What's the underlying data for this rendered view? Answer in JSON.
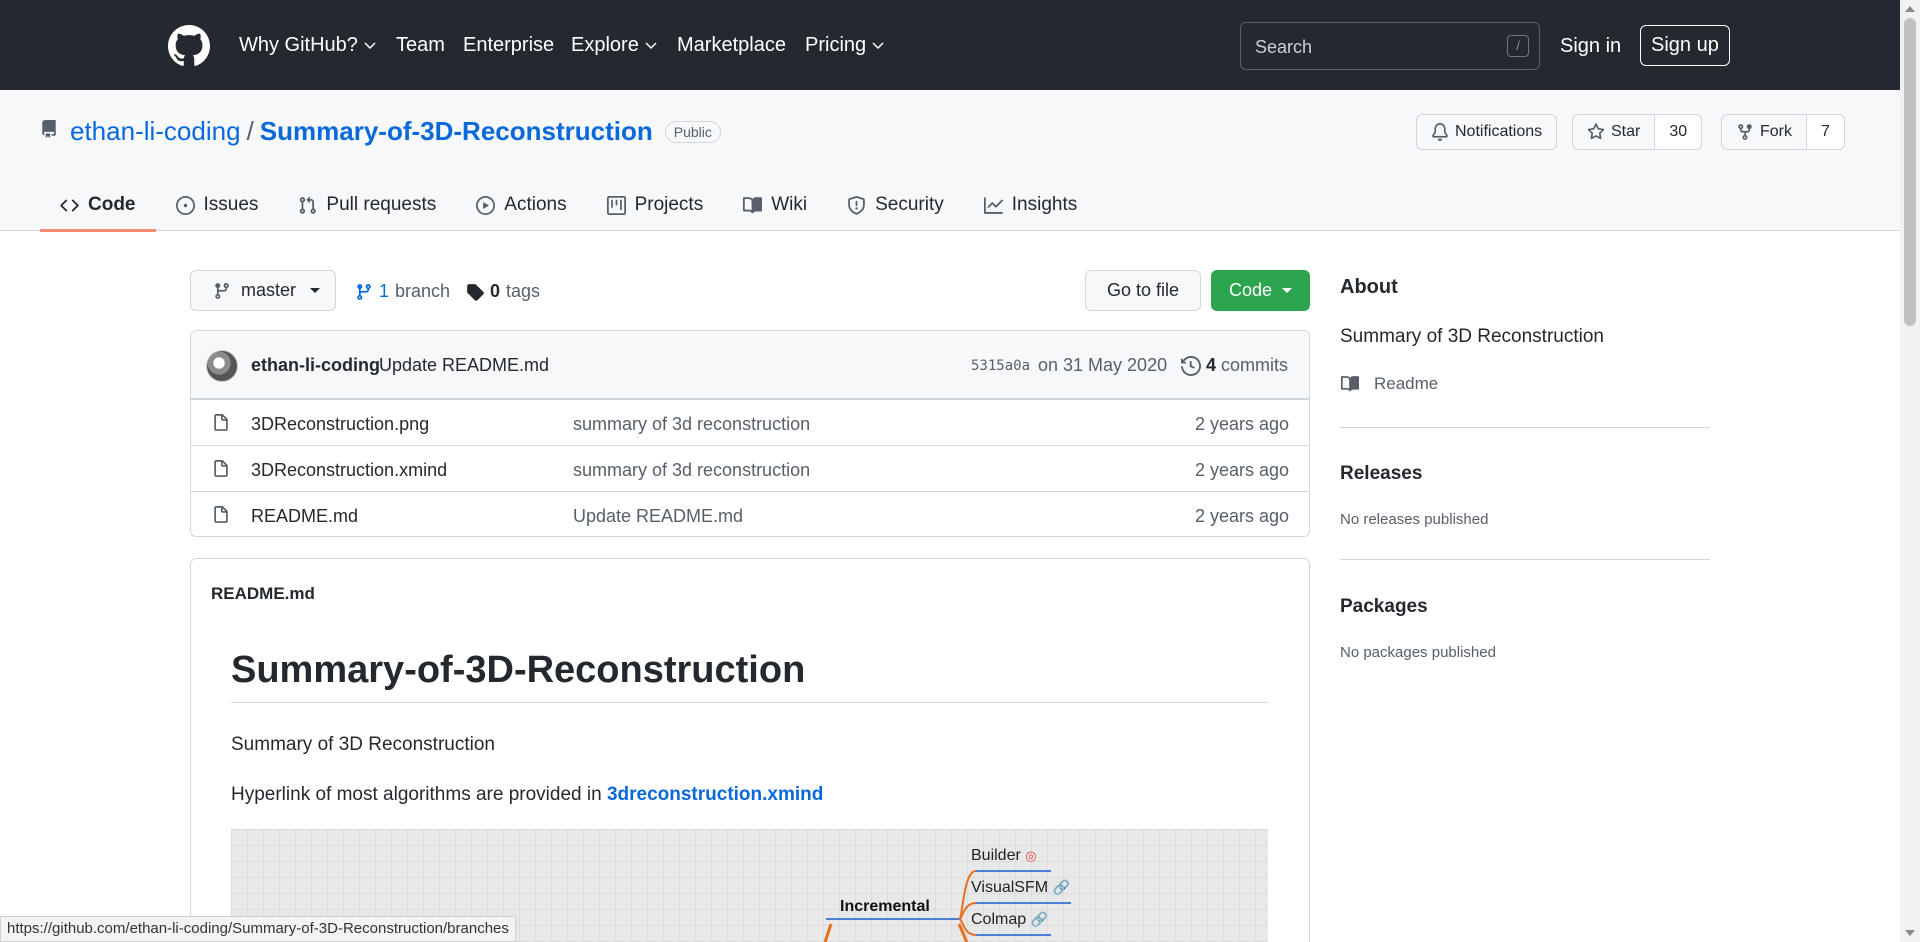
{
  "topnav": {
    "items": [
      {
        "label": "Why GitHub?",
        "dropdown": true
      },
      {
        "label": "Team",
        "dropdown": false
      },
      {
        "label": "Enterprise",
        "dropdown": false
      },
      {
        "label": "Explore",
        "dropdown": true
      },
      {
        "label": "Marketplace",
        "dropdown": false
      },
      {
        "label": "Pricing",
        "dropdown": true
      }
    ],
    "search_placeholder": "Search",
    "search_shortcut": "/",
    "signin_label": "Sign in",
    "signup_label": "Sign up"
  },
  "repo": {
    "owner": "ethan-li-coding",
    "separator": "/",
    "name": "Summary-of-3D-Reconstruction",
    "visibility": "Public",
    "notifications_label": "Notifications",
    "star_label": "Star",
    "star_count": "30",
    "fork_label": "Fork",
    "fork_count": "7"
  },
  "tabs": [
    {
      "label": "Code",
      "icon": "code-icon",
      "active": true
    },
    {
      "label": "Issues",
      "icon": "issue-icon",
      "active": false
    },
    {
      "label": "Pull requests",
      "icon": "pull-request-icon",
      "active": false
    },
    {
      "label": "Actions",
      "icon": "play-icon",
      "active": false
    },
    {
      "label": "Projects",
      "icon": "project-icon",
      "active": false
    },
    {
      "label": "Wiki",
      "icon": "book-icon",
      "active": false
    },
    {
      "label": "Security",
      "icon": "shield-icon",
      "active": false
    },
    {
      "label": "Insights",
      "icon": "graph-icon",
      "active": false
    }
  ],
  "toolbar": {
    "branch_name": "master",
    "branch_count": "1",
    "branch_word": "branch",
    "tag_count": "0",
    "tag_word": "tags",
    "goto_file_label": "Go to file",
    "code_label": "Code"
  },
  "commit": {
    "author": "ethan-li-coding",
    "message": "Update README.md",
    "sha": "5315a0a",
    "date": "on 31 May 2020",
    "count": "4",
    "count_word": "commits"
  },
  "files": [
    {
      "name": "3DReconstruction.png",
      "message": "summary of 3d reconstruction",
      "age": "2 years ago"
    },
    {
      "name": "3DReconstruction.xmind",
      "message": "summary of 3d reconstruction",
      "age": "2 years ago"
    },
    {
      "name": "README.md",
      "message": "Update README.md",
      "age": "2 years ago"
    }
  ],
  "readme": {
    "header": "README.md",
    "title": "Summary-of-3D-Reconstruction",
    "paragraph1": "Summary of 3D Reconstruction",
    "paragraph2_prefix": "Hyperlink of most algorithms are provided in",
    "paragraph2_link": "3dreconstruction.xmind",
    "mindmap": {
      "central": "Incremental",
      "nodes": [
        "Builder",
        "VisualSFM",
        "Colmap"
      ]
    }
  },
  "sidebar": {
    "about_title": "About",
    "about_desc": "Summary of 3D Reconstruction",
    "readme_label": "Readme",
    "releases_title": "Releases",
    "releases_note": "No releases published",
    "packages_title": "Packages",
    "packages_note": "No packages published"
  },
  "statusbar": {
    "url": "https://github.com/ethan-li-coding/Summary-of-3D-Reconstruction/branches"
  },
  "colors": {
    "header_bg": "#24292f",
    "link": "#0969da",
    "code_button": "#2da44e",
    "active_tab_underline": "#fd8c73"
  }
}
